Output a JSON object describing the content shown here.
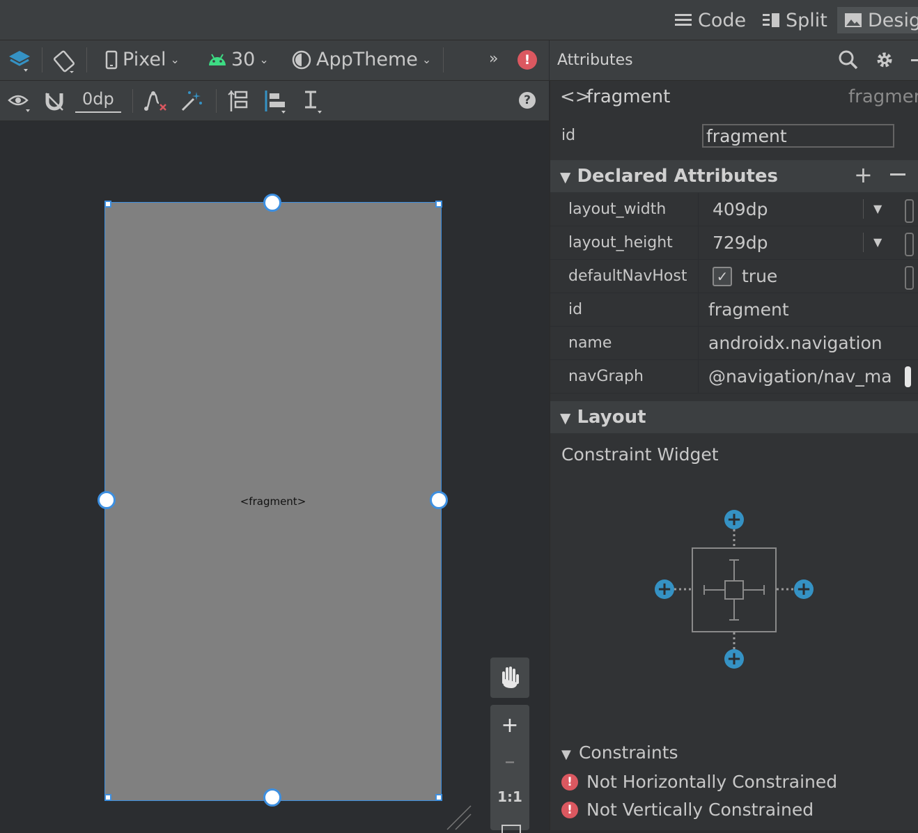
{
  "modes": {
    "code": "Code",
    "split": "Split",
    "design": "Desig"
  },
  "toolbar": {
    "device": "Pixel",
    "api": "30",
    "theme": "AppTheme",
    "margin": "0dp",
    "overflow": "»"
  },
  "canvas": {
    "fragment_label": "<fragment>",
    "zoom_reset": "1:1"
  },
  "attributes": {
    "title": "Attributes",
    "component": "fragment",
    "component_right": "fragmer",
    "id_label": "id",
    "id_value": "fragment",
    "declared_title": "Declared Attributes",
    "declared": [
      {
        "key": "layout_width",
        "value": "409dp"
      },
      {
        "key": "layout_height",
        "value": "729dp"
      },
      {
        "key": "defaultNavHost",
        "value": "true"
      },
      {
        "key": "id",
        "value": "fragment"
      },
      {
        "key": "name",
        "value": "androidx.navigation"
      },
      {
        "key": "navGraph",
        "value": "@navigation/nav_ma"
      }
    ],
    "layout_title": "Layout",
    "constraint_widget": "Constraint Widget",
    "constraints_title": "Constraints",
    "constraints": [
      "Not Horizontally Constrained",
      "Not Vertically Constrained"
    ]
  },
  "colors": {
    "accent": "#3d8fe0",
    "error": "#db5860",
    "android": "#3ddc84",
    "constraint_plus": "#3592c4"
  }
}
